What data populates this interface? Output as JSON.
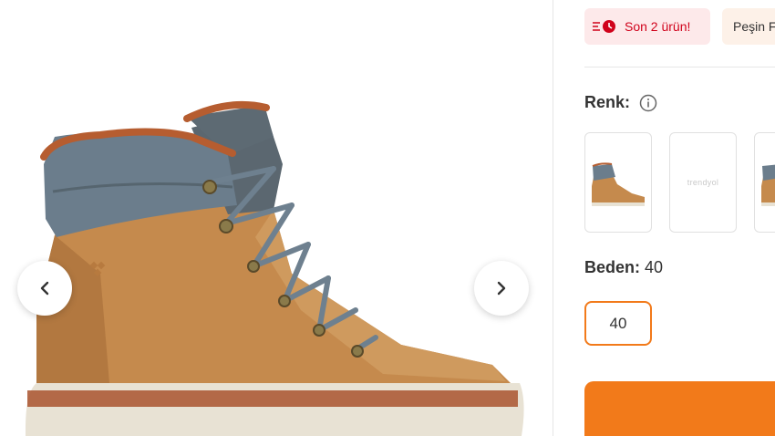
{
  "gallery": {
    "prev_icon": "chevron-left-icon",
    "next_icon": "chevron-right-icon"
  },
  "badges": {
    "stock_text": "Son 2 ürün!",
    "stock_icon": "low-stock-clock-icon",
    "payment_text": "Peşin F"
  },
  "color_section": {
    "label": "Renk:",
    "info_icon": "info-icon",
    "thumbnail_placeholder": "trendyol"
  },
  "size_section": {
    "label": "Beden:",
    "selected_value": "40",
    "options": [
      "40"
    ]
  },
  "colors": {
    "accent": "#f27a1a",
    "stock_red": "#d0021b",
    "boot_tan": "#c58a4d",
    "collar_gray": "#6b7d8c"
  }
}
